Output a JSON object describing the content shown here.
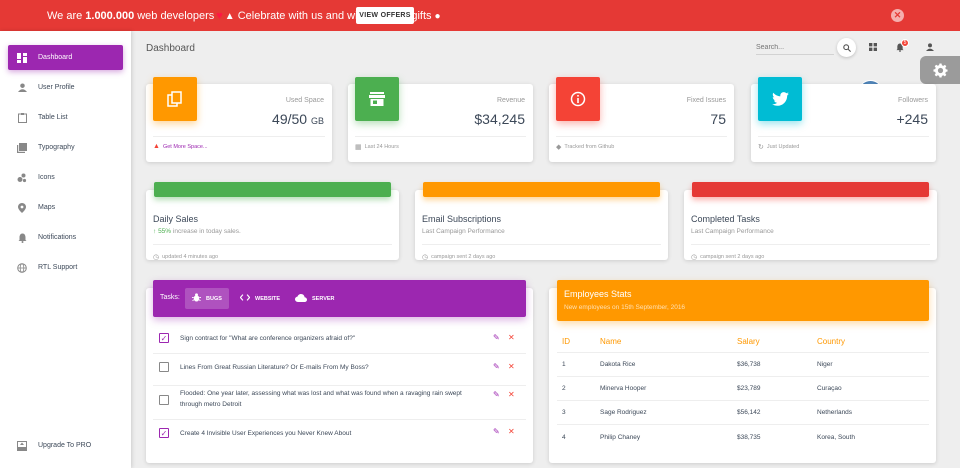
{
  "banner": {
    "text_before": "We are",
    "text_bold": "1.000.000",
    "text_mid": "web developers",
    "text_after": "Celebrate with us and win amazing gifts",
    "offers_label": "VIEW OFFERS",
    "close_icon": "close-icon"
  },
  "sidebar": {
    "items": [
      {
        "label": "Dashboard",
        "icon": "dashboard-icon"
      },
      {
        "label": "User Profile",
        "icon": "person-icon"
      },
      {
        "label": "Table List",
        "icon": "clipboard-icon"
      },
      {
        "label": "Typography",
        "icon": "library-books-icon"
      },
      {
        "label": "Icons",
        "icon": "bubble-chart-icon"
      },
      {
        "label": "Maps",
        "icon": "location-icon"
      },
      {
        "label": "Notifications",
        "icon": "bell-icon"
      },
      {
        "label": "RTL Support",
        "icon": "language-icon"
      }
    ],
    "upgrade_label": "Upgrade To PRO"
  },
  "topbar": {
    "title": "Dashboard",
    "search_placeholder": "Search...",
    "notification_count": "5"
  },
  "stats": [
    {
      "label": "Used Space",
      "value": "49/50",
      "unit": "GB",
      "footer": "Get More Space...",
      "color": "#ff9800",
      "icon": "content-copy-icon",
      "footer_icon": "warning-icon"
    },
    {
      "label": "Revenue",
      "value": "$34,245",
      "unit": "",
      "footer": "Last 24 Hours",
      "color": "#4caf50",
      "icon": "store-icon",
      "footer_icon": "date-range-icon"
    },
    {
      "label": "Fixed Issues",
      "value": "75",
      "unit": "",
      "footer": "Tracked from Github",
      "color": "#f44336",
      "icon": "info-outline-icon",
      "footer_icon": "local-offer-icon"
    },
    {
      "label": "Followers",
      "value": "+245",
      "unit": "",
      "footer": "Just Updated",
      "color": "#00bcd4",
      "icon": "twitter-icon",
      "footer_icon": "update-icon"
    }
  ],
  "charts": [
    {
      "title": "Daily Sales",
      "sub_highlight": "55%",
      "sub": "increase in today sales.",
      "footer": "updated 4 minutes ago",
      "color": "#4caf50"
    },
    {
      "title": "Email Subscriptions",
      "sub_highlight": "",
      "sub": "Last Campaign Performance",
      "footer": "campaign sent 2 days ago",
      "color": "#ff9800"
    },
    {
      "title": "Completed Tasks",
      "sub_highlight": "",
      "sub": "Last Campaign Performance",
      "footer": "campaign sent 2 days ago",
      "color": "#f44336"
    }
  ],
  "tasks": {
    "label": "Tasks:",
    "tabs": [
      {
        "label": "BUGS",
        "icon": "bug-icon"
      },
      {
        "label": "WEBSITE",
        "icon": "code-icon"
      },
      {
        "label": "SERVER",
        "icon": "cloud-icon"
      }
    ],
    "items": [
      {
        "text": "Sign contract for \"What are conference organizers afraid of?\"",
        "checked": true
      },
      {
        "text": "Lines From Great Russian Literature? Or E-mails From My Boss?",
        "checked": false
      },
      {
        "text": "Flooded: One year later, assessing what was lost and what was found when a ravaging rain swept through metro Detroit",
        "checked": false
      },
      {
        "text": "Create 4 Invisible User Experiences you Never Knew About",
        "checked": true
      }
    ]
  },
  "employees": {
    "title": "Employees Stats",
    "subtitle": "New employees on 15th September, 2016",
    "columns": [
      "ID",
      "Name",
      "Salary",
      "Country"
    ],
    "rows": [
      [
        "1",
        "Dakota Rice",
        "$36,738",
        "Niger"
      ],
      [
        "2",
        "Minerva Hooper",
        "$23,789",
        "Curaçao"
      ],
      [
        "3",
        "Sage Rodriguez",
        "$56,142",
        "Netherlands"
      ],
      [
        "4",
        "Philip Chaney",
        "$38,735",
        "Korea, South"
      ]
    ]
  },
  "colors": {
    "primary": "#9c27b0",
    "banner": "#e53935",
    "warning": "#ff9800",
    "success": "#4caf50",
    "danger": "#f44336",
    "info": "#00bcd4"
  }
}
